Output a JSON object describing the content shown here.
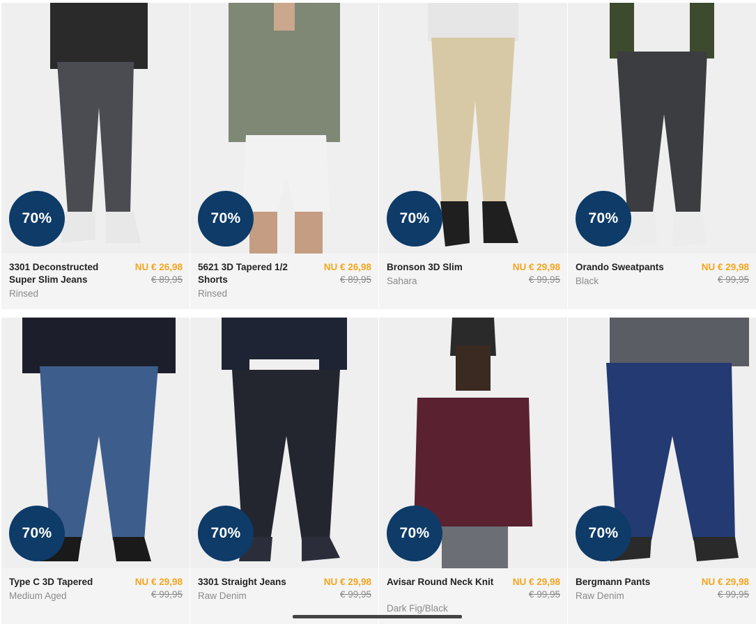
{
  "colors": {
    "badge": "#0e3b68",
    "price_now": "#f5a51d",
    "card_bg": "#f4f4f4"
  },
  "products": [
    {
      "name": "3301 Deconstructed Super Slim Jeans",
      "variant": "Rinsed",
      "badge": "70%",
      "price_now": "NU € 26,98",
      "price_old": "€ 89,95"
    },
    {
      "name": "5621 3D Tapered 1/2 Shorts",
      "variant": "Rinsed",
      "badge": "70%",
      "price_now": "NU € 26,98",
      "price_old": "€ 89,95"
    },
    {
      "name": "Bronson 3D Slim",
      "variant": "Sahara",
      "badge": "70%",
      "price_now": "NU € 29,98",
      "price_old": "€ 99,95"
    },
    {
      "name": "Orando Sweatpants",
      "variant": "Black",
      "badge": "70%",
      "price_now": "NU € 29,98",
      "price_old": "€ 99,95"
    },
    {
      "name": "Type C 3D Tapered",
      "variant": "Medium Aged",
      "badge": "70%",
      "price_now": "NU € 29,98",
      "price_old": "€ 99,95"
    },
    {
      "name": "3301 Straight Jeans",
      "variant": "Raw Denim",
      "badge": "70%",
      "price_now": "NU € 29,98",
      "price_old": "€ 99,95"
    },
    {
      "name": "Avisar Round Neck Knit",
      "variant": "Dark Fig/Black",
      "badge": "70%",
      "price_now": "NU € 29,98",
      "price_old": "€ 99,95"
    },
    {
      "name": "Bergmann Pants",
      "variant": "Raw Denim",
      "badge": "70%",
      "price_now": "NU € 29,98",
      "price_old": "€ 99,95"
    }
  ]
}
